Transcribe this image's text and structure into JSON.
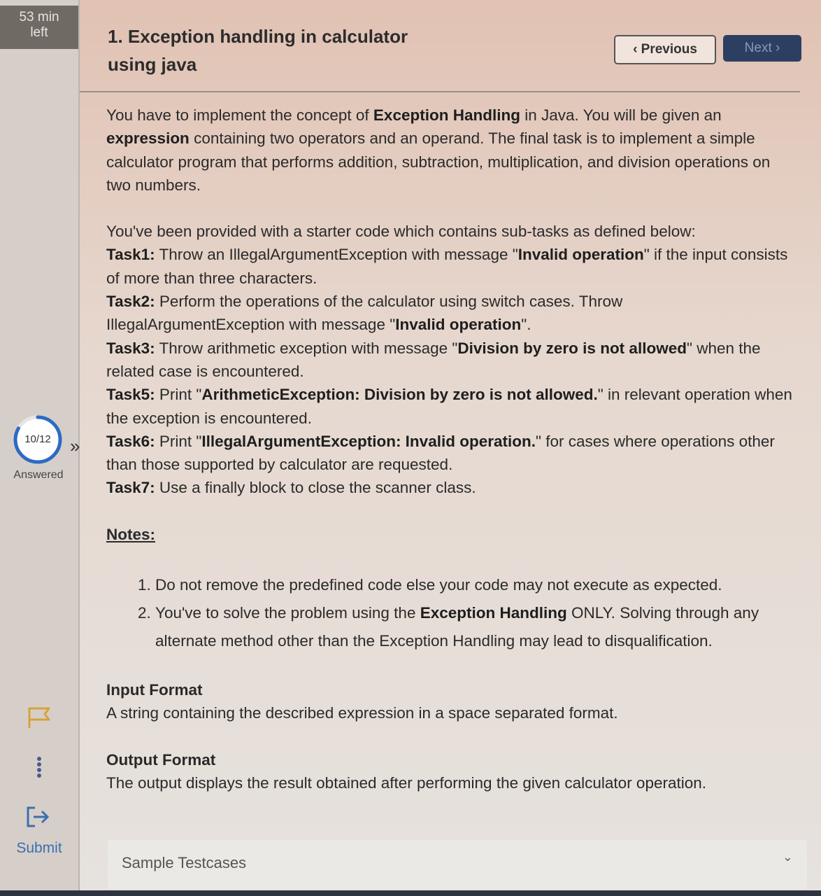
{
  "sidebar": {
    "timer": {
      "line1": "53 min",
      "line2": "left"
    },
    "progress": {
      "label": "10/12",
      "answered": 10,
      "total": 12,
      "status": "Answered"
    },
    "expand_symbol": "»",
    "submit_label": "Submit"
  },
  "header": {
    "title_line1": "1. Exception handling in calculator",
    "title_line2": "using java",
    "prev_label": "Previous",
    "next_label": "Next"
  },
  "intro": {
    "t1": "You have to implement the concept of ",
    "b1": "Exception Handling",
    "t2": " in Java. You will be given an ",
    "b2": "expression",
    "t3": " containing two operators and an operand. The final task is to implement a simple calculator program that performs addition, subtraction, multiplication, and division operations on two numbers."
  },
  "tasks": {
    "lead": "You've been provided with a starter code which contains sub-tasks as defined below:",
    "task1": {
      "label": "Task1:",
      "t1": " Throw an IllegalArgumentException with message \"",
      "b": "Invalid operation",
      "t2": "\" if the input consists of more than three characters."
    },
    "task2": {
      "label": "Task2:",
      "t1": " Perform the operations of the calculator using switch cases. Throw IllegalArgumentException with message \"",
      "b": "Invalid operation",
      "t2": "\"."
    },
    "task3": {
      "label": "Task3:",
      "t1": " Throw arithmetic exception with message \"",
      "b": "Division by zero is not allowed",
      "t2": "\" when the related case is encountered."
    },
    "task5": {
      "label": "Task5:",
      "t1": " Print \"",
      "b": "ArithmeticException: Division by zero is not allowed.",
      "t2": "\" in relevant operation when the exception is encountered."
    },
    "task6": {
      "label": "Task6:",
      "t1": " Print \"",
      "b": "IllegalArgumentException: Invalid operation.",
      "t2": "\" for cases where operations other than those supported by calculator are requested."
    },
    "task7": {
      "label": "Task7:",
      "t1": " Use a finally block to close the scanner class."
    }
  },
  "notes": {
    "heading": "Notes:",
    "item1": "Do not remove the predefined code else your code may not execute as expected.",
    "item2": {
      "t1": "You've to solve the problem using the ",
      "b": "Exception Handling",
      "t2": " ONLY. Solving through any alternate method other than the Exception Handling may lead to disqualification."
    }
  },
  "input_format": {
    "heading": "Input Format",
    "text": "A string containing the described expression in a space separated format."
  },
  "output_format": {
    "heading": "Output Format",
    "text": "The output displays the result obtained after performing the given calculator operation."
  },
  "sample": {
    "label": "Sample Testcases"
  },
  "icons": {
    "flag": "flag-icon",
    "more": "more-vertical-icon",
    "submit": "submit-icon",
    "expand": "double-chevron-right-icon",
    "chevron_left": "chevron-left-icon",
    "chevron_right": "chevron-right-icon",
    "chevron_down": "chevron-down-icon"
  },
  "colors": {
    "accent": "#2c6bc4",
    "next_button": "#2c3f63",
    "submit": "#3a6fb0"
  }
}
